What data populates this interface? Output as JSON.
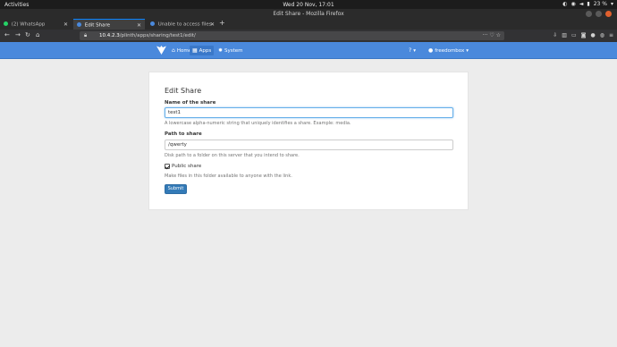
{
  "gnome": {
    "activities": "Activities",
    "clock": "Wed 20 Nov, 17:01",
    "battery": "23 %"
  },
  "window": {
    "title": "Edit Share - Mozilla Firefox"
  },
  "tabs": [
    {
      "label": "(2) WhatsApp",
      "favicon_color": "#25d366",
      "active": false
    },
    {
      "label": "Edit Share",
      "favicon_color": "#4a89dc",
      "active": true
    },
    {
      "label": "Unable to access files",
      "favicon_color": "#4a89dc",
      "active": false
    }
  ],
  "urlbar": {
    "url_host": "10.4.2.3",
    "url_path": "/plinth/apps/sharing/test1/edit/"
  },
  "appbar": {
    "home_label": "Home",
    "apps_label": "Apps",
    "system_label": "System",
    "user_label": "freedombox",
    "brand_color": "#4a89dc"
  },
  "form": {
    "title": "Edit Share",
    "name_label": "Name of the share",
    "name_value": "test1",
    "name_help": "A lowercase alpha-numeric string that uniquely identifies a share. Example: media.",
    "path_label": "Path to share",
    "path_value": "/qwerty",
    "path_help": "Disk path to a folder on this server that you intend to share.",
    "public_label": "Public share",
    "public_checked": true,
    "public_help": "Make files in this folder available to anyone with the link.",
    "submit_label": "Submit"
  }
}
